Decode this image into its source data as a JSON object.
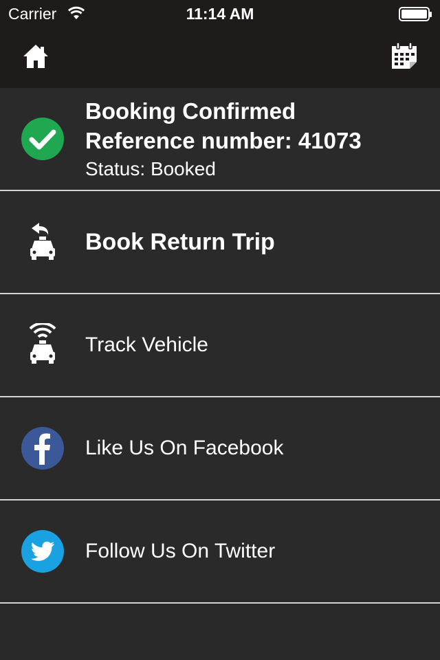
{
  "status_bar": {
    "carrier": "Carrier",
    "time": "11:14 AM"
  },
  "nav": {
    "left_icon": "home-icon",
    "right_icon": "calendar-icon"
  },
  "booking": {
    "title": "Booking Confirmed",
    "reference": "Reference number: 41073",
    "status": "Status: Booked",
    "icon": "check-circle-icon",
    "icon_color": "#1fa84f"
  },
  "menu": {
    "return_trip": {
      "label": "Book Return Trip",
      "icon": "taxi-return-icon"
    },
    "track": {
      "label": "Track Vehicle",
      "icon": "taxi-signal-icon"
    },
    "facebook": {
      "label": "Like Us On Facebook",
      "icon": "facebook-icon",
      "color": "#3b5998"
    },
    "twitter": {
      "label": "Follow Us On Twitter",
      "icon": "twitter-icon",
      "color": "#1aa1e1"
    }
  },
  "colors": {
    "background": "#282828",
    "bar": "#1e1b1a",
    "divider": "#d4d4d4"
  }
}
